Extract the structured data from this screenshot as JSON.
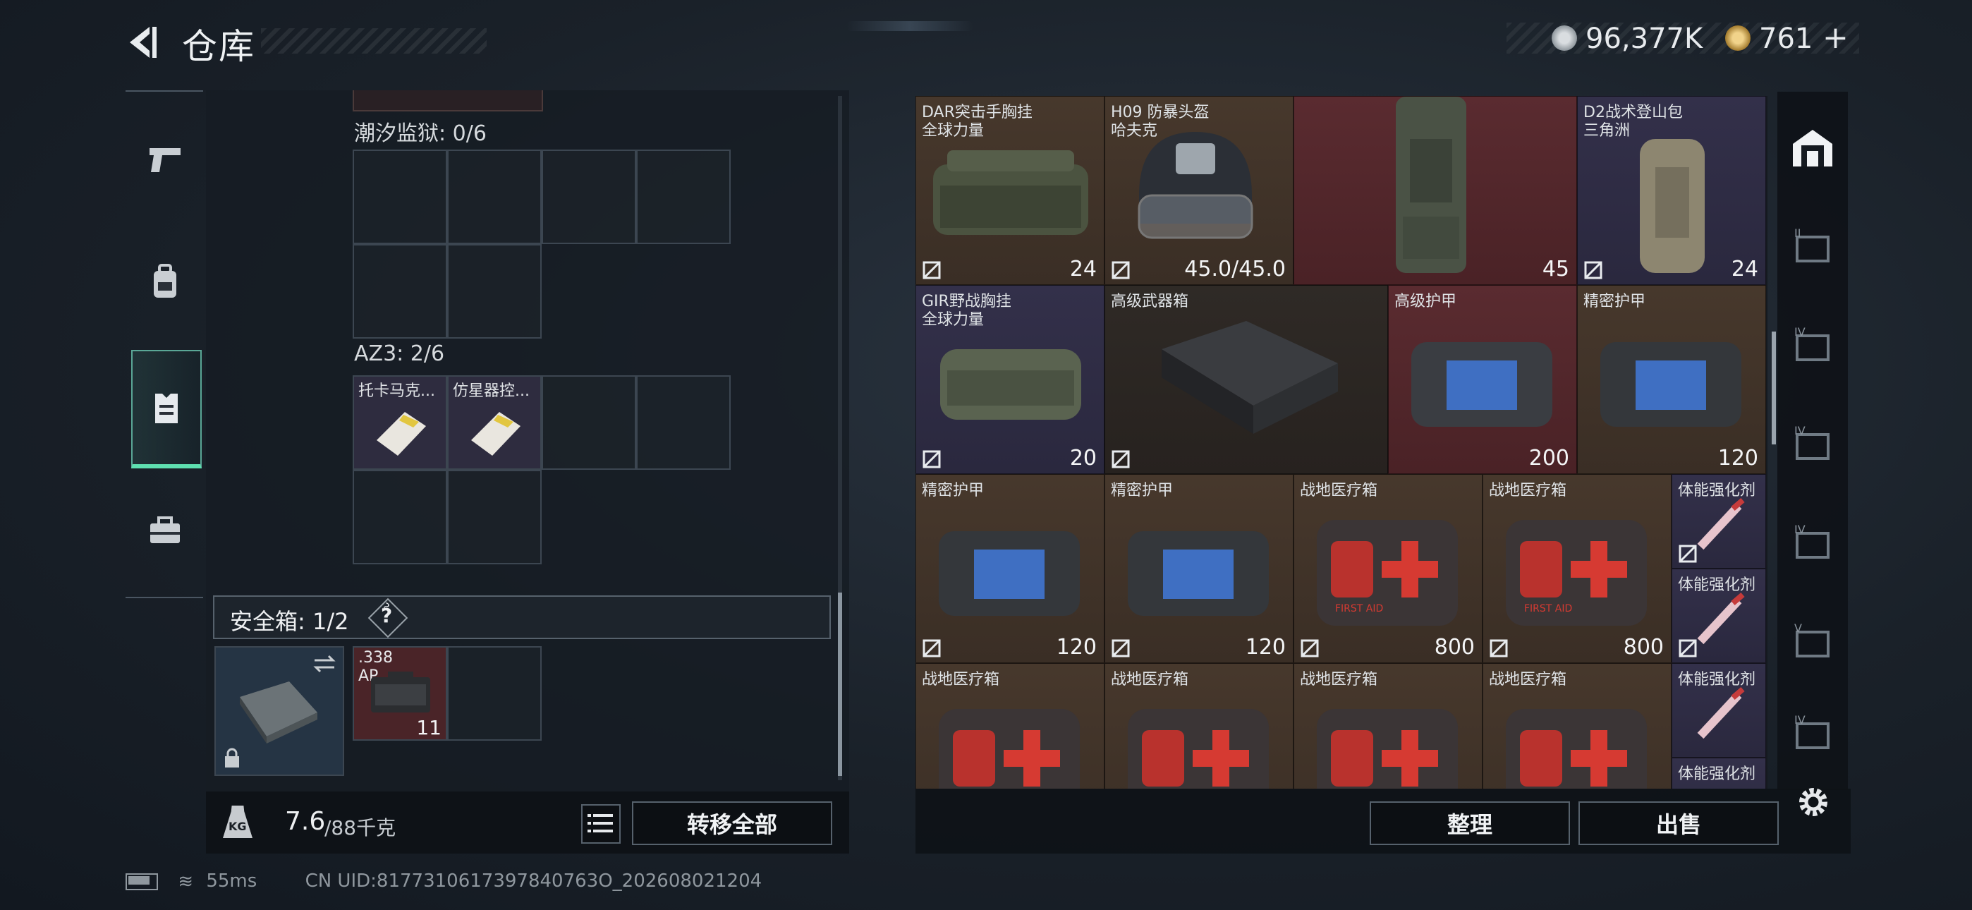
{
  "header": {
    "title": "仓库"
  },
  "currency": [
    {
      "icon": "silver-coin-icon",
      "value": "96,377K"
    },
    {
      "icon": "gold-coin-icon",
      "value": "761"
    }
  ],
  "left_nav": [
    {
      "icon": "pistol-icon"
    },
    {
      "icon": "backpack-icon"
    },
    {
      "icon": "chest-rig-icon",
      "active": true
    },
    {
      "icon": "toolbox-icon"
    }
  ],
  "containers": [
    {
      "title": "潮汐监狱: 0/6",
      "items": []
    },
    {
      "title": "AZ3: 2/6",
      "items": [
        {
          "name": "托卡马克..."
        },
        {
          "name": "仿星器控..."
        }
      ]
    }
  ],
  "safe_box": {
    "title": "安全箱: 1/2",
    "help": "?",
    "items": [
      {
        "name_line1": ".338",
        "name_line2": "AP",
        "count": "11"
      }
    ]
  },
  "weight": {
    "icon": "KG",
    "current": "7.6",
    "max": "/88千克"
  },
  "buttons": {
    "transfer_all": "转移全部",
    "sort": "整理",
    "sell": "出售"
  },
  "stash_items": [
    {
      "name": "DAR突击手胸挂",
      "sub": "全球力量",
      "value": "24",
      "stat_icon": "slots-icon",
      "bg": "brown"
    },
    {
      "name": "H09 防暴头盔",
      "sub": "哈夫克",
      "value": "45.0/45.0",
      "stat_icon": "",
      "bg": "brown"
    },
    {
      "name": "",
      "sub": "",
      "value": "45",
      "stat_icon": "capacity-icon",
      "bg": "red"
    },
    {
      "name": "D2战术登山包",
      "sub": "三角洲",
      "value": "24",
      "stat_icon": "capacity-icon",
      "bg": "purple"
    },
    {
      "name": "GIR野战胸挂",
      "sub": "全球力量",
      "value": "20",
      "stat_icon": "slots-icon",
      "bg": "purple"
    },
    {
      "name": "高级武器箱",
      "sub": "",
      "value": "",
      "stat_icon": "",
      "bg": "dark"
    },
    {
      "name": "高级护甲",
      "sub": "",
      "value": "200",
      "stat_icon": "shield-icon",
      "bg": "red"
    },
    {
      "name": "精密护甲",
      "sub": "",
      "value": "120",
      "stat_icon": "shield-icon",
      "bg": "brown"
    },
    {
      "name": "精密护甲",
      "sub": "",
      "value": "120",
      "stat_icon": "shield-icon",
      "bg": "brown"
    },
    {
      "name": "精密护甲",
      "sub": "",
      "value": "120",
      "stat_icon": "shield-icon",
      "bg": "brown"
    },
    {
      "name": "战地医疗箱",
      "sub": "",
      "value": "800",
      "stat_icon": "plus-icon",
      "bg": "brown"
    },
    {
      "name": "战地医疗箱",
      "sub": "",
      "value": "800",
      "stat_icon": "plus-icon",
      "bg": "brown"
    },
    {
      "name": "体能强化剂",
      "sub": "",
      "value": "",
      "stat_icon": "",
      "bg": "purple"
    },
    {
      "name": "体能强化剂",
      "sub": "",
      "value": "",
      "stat_icon": "",
      "bg": "purple"
    },
    {
      "name": "战地医疗箱",
      "sub": "",
      "value": "",
      "stat_icon": "",
      "bg": "brown"
    },
    {
      "name": "战地医疗箱",
      "sub": "",
      "value": "",
      "stat_icon": "",
      "bg": "brown"
    },
    {
      "name": "战地医疗箱",
      "sub": "",
      "value": "",
      "stat_icon": "",
      "bg": "brown"
    },
    {
      "name": "战地医疗箱",
      "sub": "",
      "value": "",
      "stat_icon": "",
      "bg": "brown"
    },
    {
      "name": "体能强化剂",
      "sub": "",
      "value": "",
      "stat_icon": "",
      "bg": "purple"
    },
    {
      "name": "体能强化剂",
      "sub": "",
      "value": "",
      "stat_icon": "",
      "bg": "purple"
    }
  ],
  "med_label": "FIRST AID",
  "right_nav": [
    {
      "icon": "stash-icon",
      "label": ""
    },
    {
      "icon": "stash-page-2-icon",
      "label": "II"
    },
    {
      "icon": "stash-page-3-icon",
      "label": "IV"
    },
    {
      "icon": "stash-page-4-icon",
      "label": "IV"
    },
    {
      "icon": "stash-page-5-icon",
      "label": "IV"
    },
    {
      "icon": "stash-page-6-icon",
      "label": "V"
    },
    {
      "icon": "stash-page-7-icon",
      "label": "IV"
    }
  ],
  "status": {
    "ping": "55ms",
    "uid": "CN UID:8177310617397840763O_202608021204"
  }
}
